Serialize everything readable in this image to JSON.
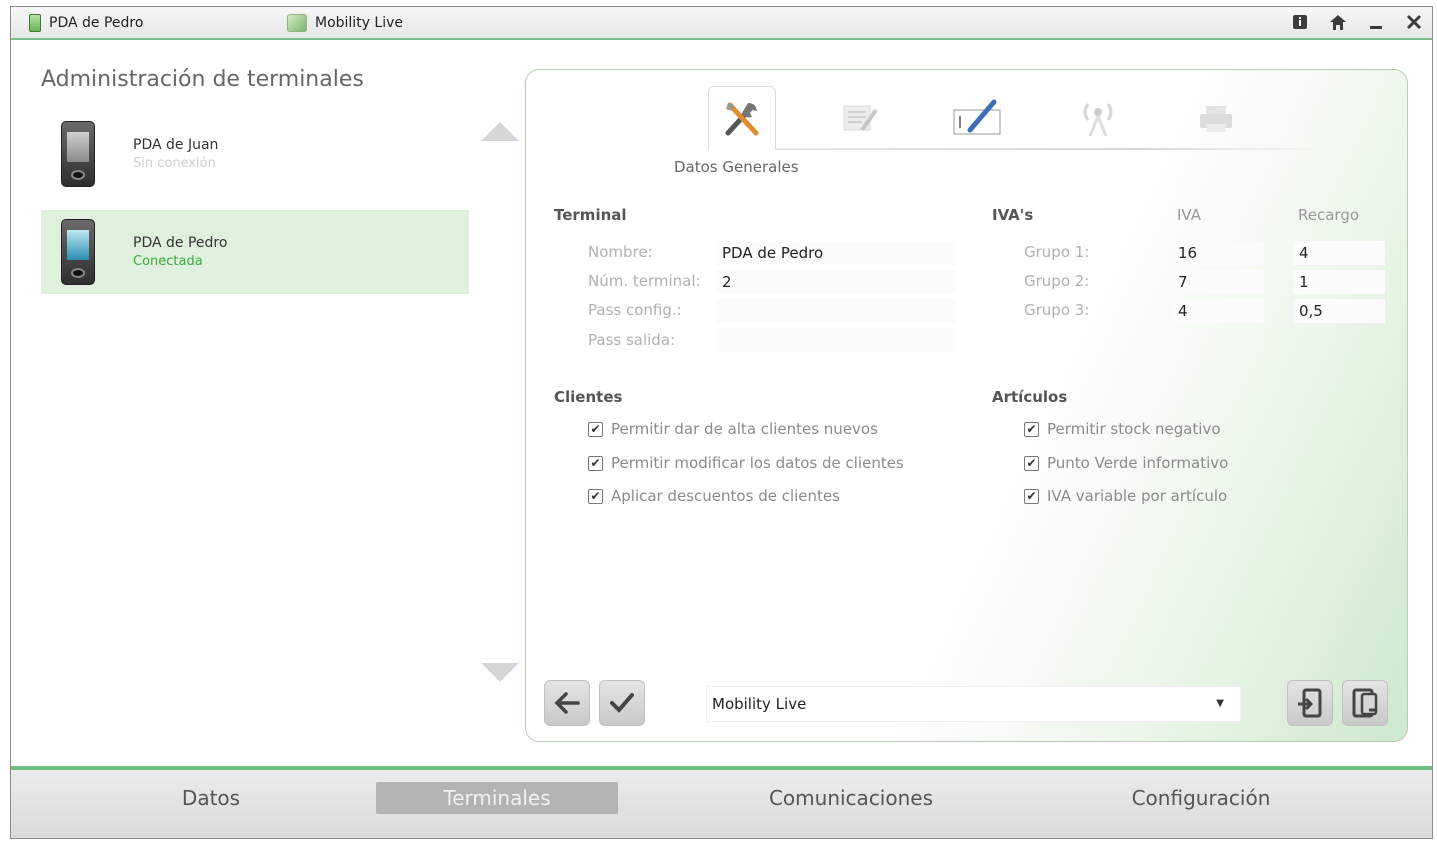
{
  "titlebar": {
    "left_title": "PDA de Pedro",
    "app_title": "Mobility Live"
  },
  "left_panel": {
    "title": "Administración de terminales",
    "devices": [
      {
        "name": "PDA de Juan",
        "status": "Sin conexión",
        "selected": false
      },
      {
        "name": "PDA de Pedro",
        "status": "Conectada",
        "selected": true
      }
    ]
  },
  "tabs": {
    "active_label": "Datos Generales",
    "icons": [
      "tools-icon",
      "notepad-icon",
      "pen-icon",
      "antenna-icon",
      "printer-icon"
    ]
  },
  "terminal": {
    "section_title": "Terminal",
    "fields": [
      {
        "label": "Nombre:",
        "value": "PDA de Pedro"
      },
      {
        "label": "Núm. terminal:",
        "value": "2"
      },
      {
        "label": "Pass config.:",
        "value": ""
      },
      {
        "label": "Pass salida:",
        "value": ""
      }
    ]
  },
  "ivas": {
    "section_title": "IVA's",
    "col_iva": "IVA",
    "col_recargo": "Recargo",
    "rows": [
      {
        "label": "Grupo 1:",
        "iva": "16",
        "recargo": "4"
      },
      {
        "label": "Grupo 2:",
        "iva": "7",
        "recargo": "1"
      },
      {
        "label": "Grupo 3:",
        "iva": "4",
        "recargo": "0,5"
      }
    ]
  },
  "clientes": {
    "section_title": "Clientes",
    "options": [
      {
        "label": "Permitir dar de alta clientes nuevos",
        "checked": true
      },
      {
        "label": "Permitir modificar los datos de clientes",
        "checked": true
      },
      {
        "label": "Aplicar descuentos de clientes",
        "checked": true
      }
    ]
  },
  "articulos": {
    "section_title": "Artículos",
    "options": [
      {
        "label": "Permitir stock negativo",
        "checked": true
      },
      {
        "label": "Punto Verde informativo",
        "checked": true
      },
      {
        "label": "IVA variable por artículo",
        "checked": true
      }
    ]
  },
  "footer": {
    "selected_app": "Mobility Live"
  },
  "bottom_nav": {
    "items": [
      "Datos",
      "Terminales",
      "Comunicaciones",
      "Configuración"
    ],
    "active": "Terminales"
  },
  "colors": {
    "accent_green": "#6fbf83",
    "connected_green": "#3fa843",
    "selected_bg": "#dff0dc"
  }
}
